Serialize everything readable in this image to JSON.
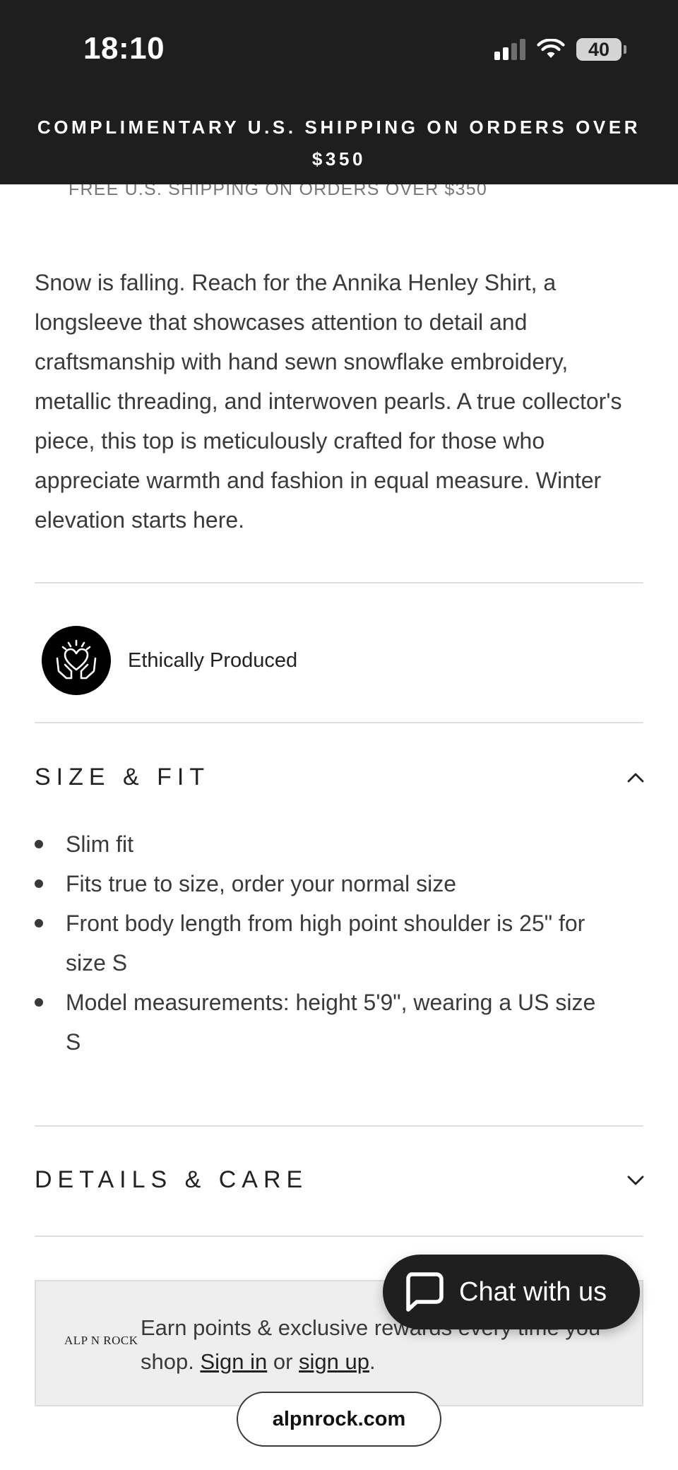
{
  "status_bar": {
    "time": "18:10",
    "battery": "40",
    "icons": [
      "cellular-signal-icon",
      "wifi-icon",
      "battery-icon"
    ]
  },
  "announcement": {
    "line1": "COMPLIMENTARY U.S. SHIPPING ON ORDERS OVER",
    "line2": "$350"
  },
  "shipping_note": "FREE U.S. SHIPPING ON ORDERS OVER $350",
  "description": "Snow is falling. Reach for the Annika Henley Shirt, a longsleeve that showcases attention to detail and craftsmanship with hand sewn snowflake embroidery, metallic threading, and interwoven pearls. A true collector's piece, this top is meticulously crafted for those who appreciate warmth and fashion in equal measure. Winter elevation starts here.",
  "ethically_produced": {
    "label": "Ethically Produced",
    "icon": "hands-heart-icon"
  },
  "size_fit": {
    "title": "SIZE & FIT",
    "expanded": true,
    "items": [
      "Slim fit",
      "Fits true to size, order your normal size",
      "Front body length from high point shoulder is 25\" for size S",
      "Model measurements: height 5'9\", wearing a US size S"
    ]
  },
  "details_care": {
    "title": "DETAILS & CARE",
    "expanded": false
  },
  "rewards": {
    "logo": "ALP N ROCK",
    "text_prefix": "Earn points & exclusive rewards every time you shop. ",
    "sign_in": "Sign in",
    "or": " or ",
    "sign_up": "sign up",
    "suffix": "."
  },
  "chat": {
    "label": "Chat with us",
    "icon": "chat-bubble-icon"
  },
  "browser": {
    "domain": "alpnrock.com"
  },
  "colors": {
    "topbar_bg": "#1e1e1e",
    "chat_bg": "#1f1f1f",
    "rewards_bg": "#eeeeee",
    "text": "#3a3a3a"
  }
}
